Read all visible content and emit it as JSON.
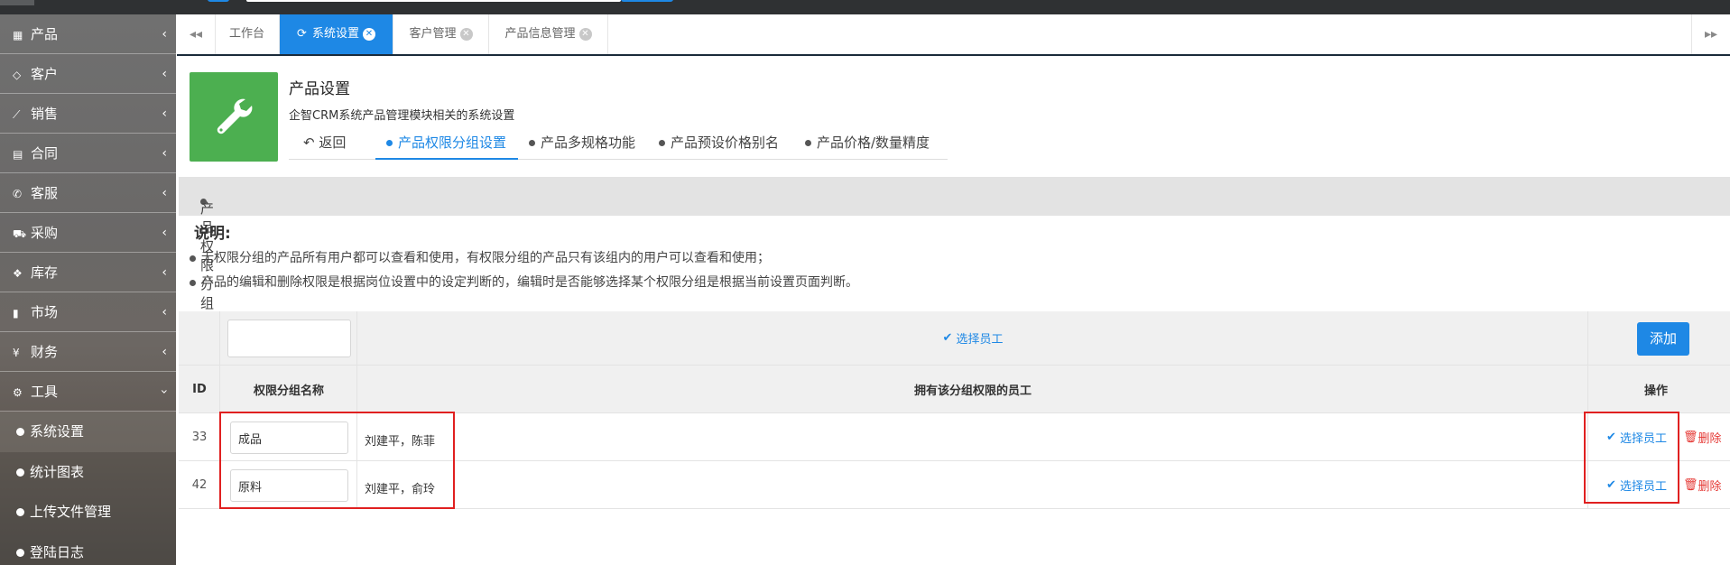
{
  "sidebar": {
    "items": [
      {
        "label": "产品",
        "icon": "grid-icon"
      },
      {
        "label": "客户",
        "icon": "diamond-icon"
      },
      {
        "label": "销售",
        "icon": "line-chart-icon"
      },
      {
        "label": "合同",
        "icon": "document-icon"
      },
      {
        "label": "客服",
        "icon": "phone-icon"
      },
      {
        "label": "采购",
        "icon": "cart-icon"
      },
      {
        "label": "库存",
        "icon": "cubes-icon"
      },
      {
        "label": "市场",
        "icon": "bookmark-icon"
      },
      {
        "label": "财务",
        "icon": "yen-icon"
      },
      {
        "label": "工具",
        "icon": "gear-icon"
      }
    ],
    "subitems": [
      {
        "label": "系统设置"
      },
      {
        "label": "统计图表"
      },
      {
        "label": "上传文件管理"
      },
      {
        "label": "登陆日志"
      }
    ]
  },
  "tabs": [
    {
      "label": "工作台"
    },
    {
      "label": "系统设置"
    },
    {
      "label": "客户管理"
    },
    {
      "label": "产品信息管理"
    }
  ],
  "page": {
    "title": "产品设置",
    "description": "企智CRM系统产品管理模块相关的系统设置",
    "subnav": [
      {
        "label": "返回"
      },
      {
        "label": "产品权限分组设置"
      },
      {
        "label": "产品多规格功能"
      },
      {
        "label": "产品预设价格别名"
      },
      {
        "label": "产品价格/数量精度"
      }
    ]
  },
  "section": {
    "title": "产品权限分组设置",
    "notes_title": "说明:",
    "notes": [
      "无权限分组的产品所有用户都可以查看和使用，有权限分组的产品只有该组内的用户可以查看和使用；",
      "产品的编辑和删除权限是根据岗位设置中的设定判断的，编辑时是否能够选择某个权限分组是根据当前设置页面判断。"
    ]
  },
  "table": {
    "add_row": {
      "name_value": "",
      "choose_staff_label": "选择员工",
      "add_label": "添加"
    },
    "headers": [
      "ID",
      "权限分组名称",
      "拥有该分组权限的员工",
      "操作"
    ],
    "rows": [
      {
        "id": "33",
        "name": "成品",
        "staff": "刘建平，陈菲",
        "choose_label": "选择员工",
        "delete_label": "删除"
      },
      {
        "id": "42",
        "name": "原料",
        "staff": "刘建平，俞玲",
        "choose_label": "选择员工",
        "delete_label": "删除"
      }
    ]
  },
  "colors": {
    "accent": "#1e88e5",
    "success": "#4caf50",
    "danger": "#e53935",
    "annotation": "#e02020"
  }
}
